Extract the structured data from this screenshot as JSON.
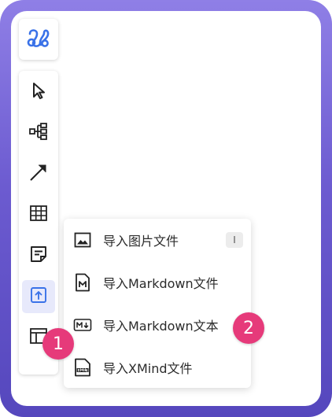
{
  "app": {
    "logo_icon": "brand-logo-icon",
    "accent_color": "#3a72e8"
  },
  "toolbar": {
    "tools": [
      {
        "name": "select-tool",
        "icon": "pointer-arrow-icon"
      },
      {
        "name": "mindmap-tool",
        "icon": "mindmap-tree-icon"
      },
      {
        "name": "arrow-tool",
        "icon": "diagonal-arrow-icon"
      },
      {
        "name": "table-tool",
        "icon": "table-grid-icon"
      },
      {
        "name": "note-tool",
        "icon": "sticky-note-icon"
      },
      {
        "name": "import-tool",
        "icon": "upload-box-icon",
        "active": true
      },
      {
        "name": "template-tool",
        "icon": "layout-icon"
      }
    ]
  },
  "import_menu": {
    "items": [
      {
        "label": "导入图片文件",
        "icon": "image-file-icon",
        "shortcut": "I"
      },
      {
        "label": "导入Markdown文件",
        "icon": "markdown-file-icon"
      },
      {
        "label": "导入Markdown文本",
        "icon": "markdown-text-icon"
      },
      {
        "label": "导入XMind文件",
        "icon": "xmind-file-icon"
      }
    ]
  },
  "annotations": {
    "step1": "1",
    "step2": "2",
    "badge_color": "#e63a7a"
  }
}
